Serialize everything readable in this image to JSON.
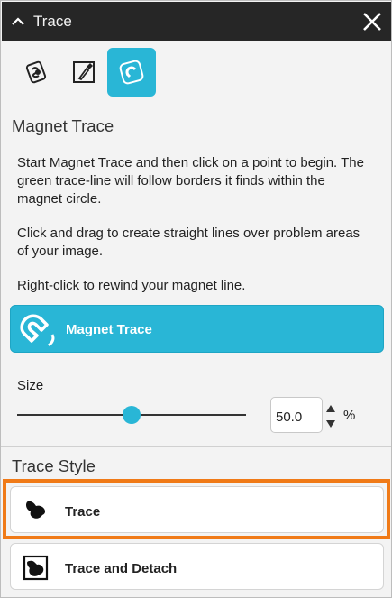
{
  "panel": {
    "title": "Trace"
  },
  "tools": [
    {
      "icon": "basic-trace-icon",
      "active": false
    },
    {
      "icon": "pen-trace-icon",
      "active": false
    },
    {
      "icon": "magnet-trace-icon",
      "active": true
    }
  ],
  "magnet": {
    "heading": "Magnet Trace",
    "desc1": "Start Magnet Trace and then click on a point to begin. The green trace-line will follow borders it finds within the magnet circle.",
    "desc2": "Click and drag to create straight lines over problem areas of your image.",
    "desc3": "Right-click to rewind your magnet line.",
    "button_label": "Magnet Trace"
  },
  "size": {
    "label": "Size",
    "value": "50.0",
    "unit": "%",
    "slider_fraction": 0.5
  },
  "trace_style": {
    "heading": "Trace Style",
    "options": [
      {
        "label": "Trace",
        "icon": "trace-style-icon",
        "selected": true
      },
      {
        "label": "Trace and Detach",
        "icon": "trace-detach-icon",
        "selected": false
      }
    ]
  },
  "colors": {
    "accent": "#29b6d6",
    "highlight": "#f07a17",
    "titlebar": "#262626"
  }
}
